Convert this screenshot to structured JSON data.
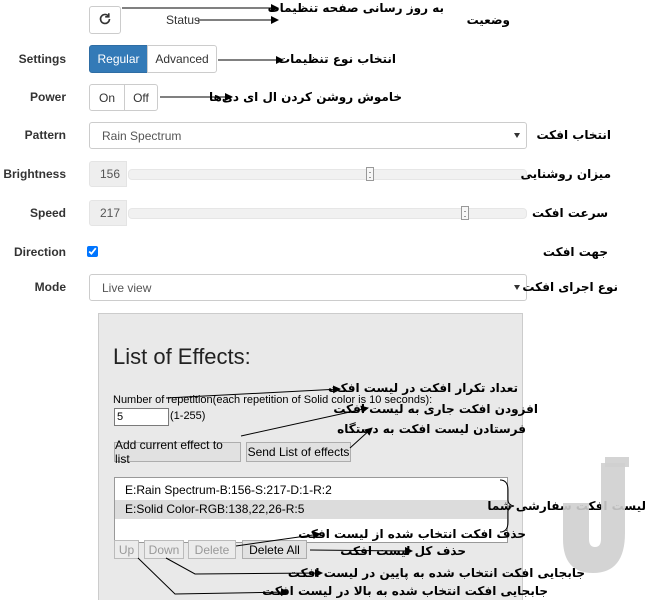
{
  "status": {
    "label": "Status",
    "refresh_icon": "refresh-icon"
  },
  "settings": {
    "label": "Settings",
    "options": [
      "Regular",
      "Advanced"
    ],
    "selected": "Regular"
  },
  "power": {
    "label": "Power",
    "on": "On",
    "off": "Off"
  },
  "pattern": {
    "label": "Pattern",
    "value": "Rain Spectrum"
  },
  "brightness": {
    "label": "Brightness",
    "value": "156",
    "level": 0.61
  },
  "speed": {
    "label": "Speed",
    "value": "217",
    "level": 0.85
  },
  "direction": {
    "label": "Direction",
    "checked": true
  },
  "mode": {
    "label": "Mode",
    "value": "Live view"
  },
  "effects": {
    "title": "List of Effects:",
    "repetition_label": "Number of repetition(each repetition of Solid color is 10 seconds):",
    "repetition_value": "5",
    "repetition_range": "(1-255)",
    "add_button": "Add current effect to list",
    "send_button": "Send List of effects",
    "items": [
      "E:Rain Spectrum-B:156-S:217-D:1-R:2",
      "E:Solid Color-RGB:138,22,26-R:5"
    ],
    "selected_index": 1,
    "up_button": "Up",
    "down_button": "Down",
    "delete_button": "Delete",
    "delete_all_button": "Delete All"
  },
  "annotations": {
    "refresh": "به روز رسانی صفحه تنظیمات",
    "status": "وضعیت",
    "settings": "انتخاب نوع تنظیمات",
    "power": "خاموش روشن کردن ال ای دی‌ها",
    "pattern": "انتخاب افکت",
    "brightness": "میزان روشنایی",
    "speed": "سرعت افکت",
    "direction": "جهت افکت",
    "mode": "نوع اجرای افکت",
    "repetition": "تعداد تکرار افکت در لیست افکت",
    "add": "افزودن افکت جاری به لیست افکت",
    "send": "فرستادن لیست افکت به دستگاه",
    "list": "لیست افکت سفارشی شما",
    "delete": "حذف افکت انتخاب شده از لیست افکت",
    "delete_all": "حذف کل لیست افکت",
    "down": "جابجایی افکت انتخاب شده به پایین در لیست افکت",
    "up": "جابجایی افکت انتخاب شده به بالا در لیست افکت"
  },
  "colors": {
    "primary": "#337ab7",
    "selected_row": "#dcdcdc"
  }
}
